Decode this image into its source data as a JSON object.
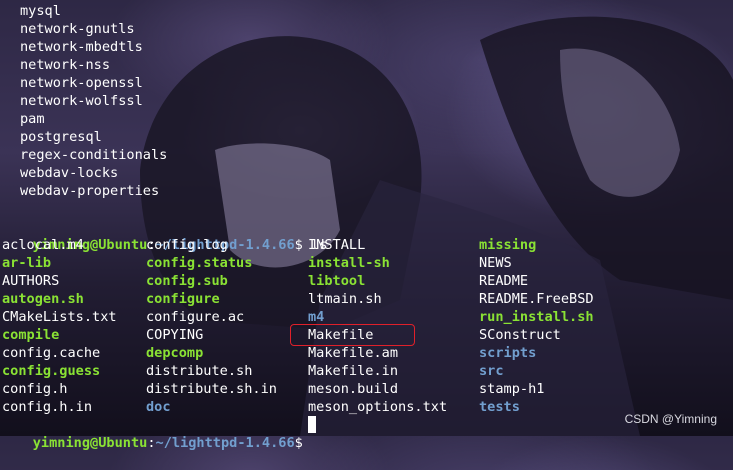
{
  "scrollback": [
    "mysql",
    "network-gnutls",
    "network-mbedtls",
    "network-nss",
    "network-openssl",
    "network-wolfssl",
    "pam",
    "postgresql",
    "regex-conditionals",
    "webdav-locks",
    "webdav-properties"
  ],
  "prompt": {
    "user_host": "yimning@Ubuntu",
    "separator": ":",
    "path": "~/lighttpd-1.4.66",
    "symbol": "$",
    "command": " ls"
  },
  "ls_output": {
    "columns": [
      [
        {
          "name": "aclocal.m4",
          "type": "file"
        },
        {
          "name": "ar-lib",
          "type": "exe"
        },
        {
          "name": "AUTHORS",
          "type": "file"
        },
        {
          "name": "autogen.sh",
          "type": "exe"
        },
        {
          "name": "CMakeLists.txt",
          "type": "file"
        },
        {
          "name": "compile",
          "type": "exe"
        },
        {
          "name": "config.cache",
          "type": "file"
        },
        {
          "name": "config.guess",
          "type": "exe"
        },
        {
          "name": "config.h",
          "type": "file"
        },
        {
          "name": "config.h.in",
          "type": "file"
        }
      ],
      [
        {
          "name": "config.log",
          "type": "file"
        },
        {
          "name": "config.status",
          "type": "exe"
        },
        {
          "name": "config.sub",
          "type": "exe"
        },
        {
          "name": "configure",
          "type": "exe"
        },
        {
          "name": "configure.ac",
          "type": "file"
        },
        {
          "name": "COPYING",
          "type": "file"
        },
        {
          "name": "depcomp",
          "type": "exe"
        },
        {
          "name": "distribute.sh",
          "type": "file"
        },
        {
          "name": "distribute.sh.in",
          "type": "file"
        },
        {
          "name": "doc",
          "type": "dir"
        }
      ],
      [
        {
          "name": "INSTALL",
          "type": "file"
        },
        {
          "name": "install-sh",
          "type": "exe"
        },
        {
          "name": "libtool",
          "type": "exe"
        },
        {
          "name": "ltmain.sh",
          "type": "file"
        },
        {
          "name": "m4",
          "type": "dir"
        },
        {
          "name": "Makefile",
          "type": "file"
        },
        {
          "name": "Makefile.am",
          "type": "file"
        },
        {
          "name": "Makefile.in",
          "type": "file"
        },
        {
          "name": "meson.build",
          "type": "file"
        },
        {
          "name": "meson_options.txt",
          "type": "file"
        }
      ],
      [
        {
          "name": "missing",
          "type": "exe"
        },
        {
          "name": "NEWS",
          "type": "file"
        },
        {
          "name": "README",
          "type": "file"
        },
        {
          "name": "README.FreeBSD",
          "type": "file"
        },
        {
          "name": "run_install.sh",
          "type": "exe"
        },
        {
          "name": "SConstruct",
          "type": "file"
        },
        {
          "name": "scripts",
          "type": "dir"
        },
        {
          "name": "src",
          "type": "dir"
        },
        {
          "name": "stamp-h1",
          "type": "file"
        },
        {
          "name": "tests",
          "type": "dir"
        }
      ]
    ]
  },
  "final_prompt": {
    "user_host": "yimning@Ubuntu",
    "separator": ":",
    "path": "~/lighttpd-1.4.66",
    "symbol": "$"
  },
  "watermark": "CSDN @Yimning",
  "colors": {
    "exe": "#8ae234",
    "dir": "#729fcf",
    "plain": "#ffffff",
    "highlight_box": "#e0202a"
  },
  "icons": [
    "terminal-cursor"
  ]
}
